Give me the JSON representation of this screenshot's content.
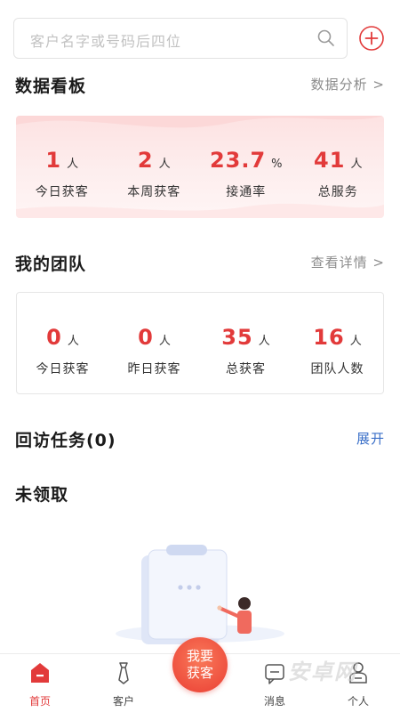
{
  "search": {
    "placeholder": "客户名字或号码后四位"
  },
  "dashboard": {
    "title": "数据看板",
    "link": "数据分析 >",
    "stats": [
      {
        "value": "1",
        "unit": "人",
        "label": "今日获客"
      },
      {
        "value": "2",
        "unit": "人",
        "label": "本周获客"
      },
      {
        "value": "23.7",
        "unit": "%",
        "label": "接通率"
      },
      {
        "value": "41",
        "unit": "人",
        "label": "总服务"
      }
    ]
  },
  "team": {
    "title": "我的团队",
    "link": "查看详情 >",
    "stats": [
      {
        "value": "0",
        "unit": "人",
        "label": "今日获客"
      },
      {
        "value": "0",
        "unit": "人",
        "label": "昨日获客"
      },
      {
        "value": "35",
        "unit": "人",
        "label": "总获客"
      },
      {
        "value": "16",
        "unit": "人",
        "label": "团队人数"
      }
    ]
  },
  "followup": {
    "title": "回访任务(0)",
    "expand": "展开"
  },
  "unclaimed": {
    "title": "未领取"
  },
  "tabbar": {
    "items": [
      {
        "label": "首页",
        "icon": "home-icon",
        "active": true
      },
      {
        "label": "客户",
        "icon": "tie-icon"
      },
      {
        "label": "消息",
        "icon": "message-icon"
      },
      {
        "label": "个人",
        "icon": "person-icon"
      }
    ],
    "center": {
      "line1": "我要",
      "line2": "获客"
    }
  },
  "watermark": "安卓网",
  "colors": {
    "accent": "#e23a3a",
    "link": "#3a6fc8"
  }
}
